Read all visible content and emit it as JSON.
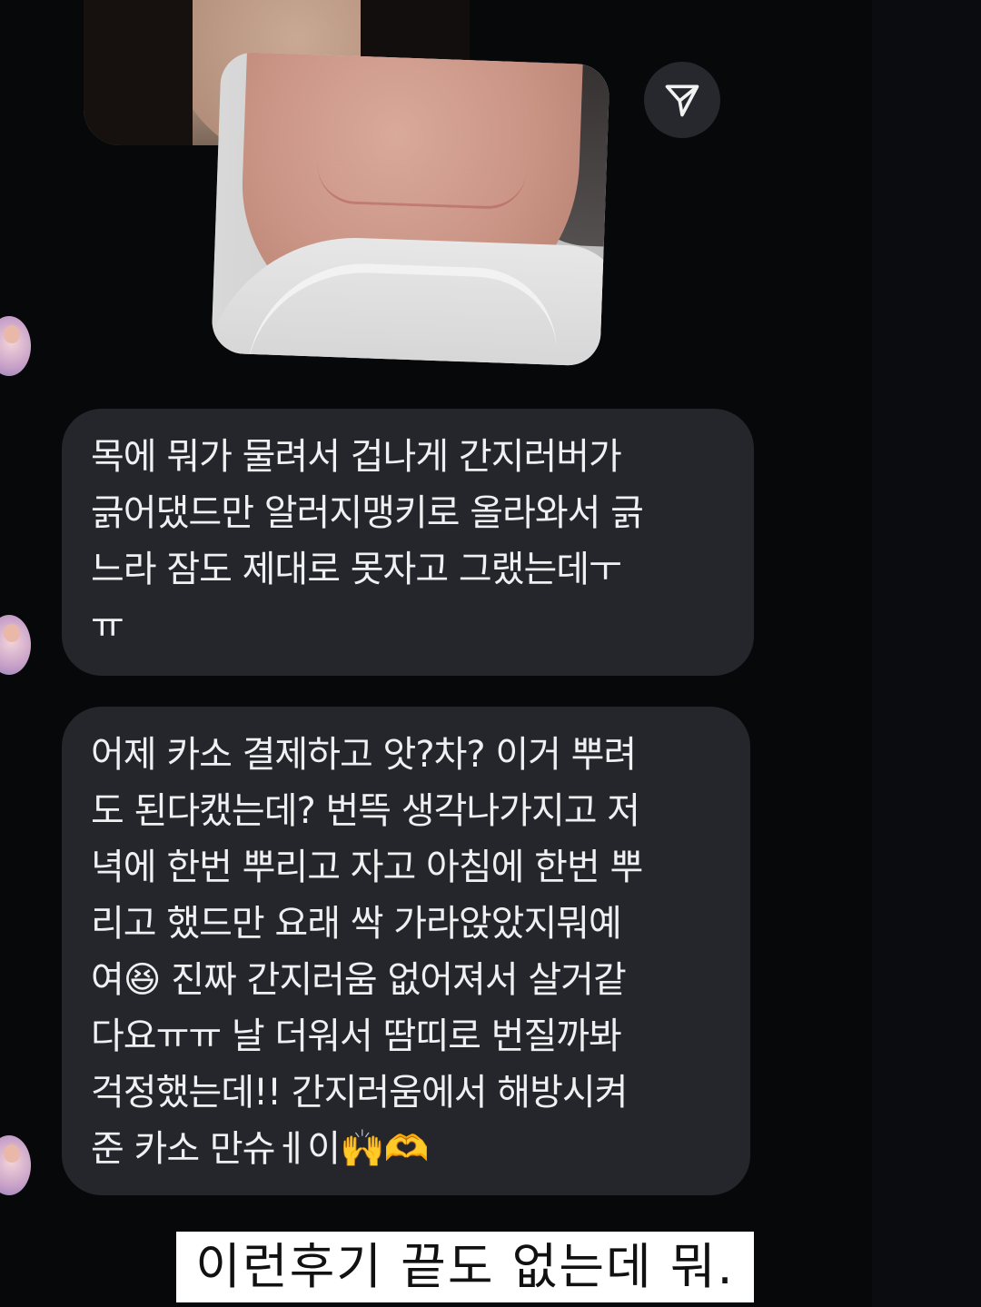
{
  "messages": [
    {
      "text": "목에 뭐가 물려서 겁나게 간지러버가\n긁어댔드만 알러지맹키로 올라와서 긁\n느라 잠도 제대로 못자고 그랬는데ㅜ\nㅠ"
    },
    {
      "text": "어제 카소 결제하고 앗?차? 이거 뿌려\n도 된다캤는데? 번뜩 생각나가지고 저\n녁에 한번 뿌리고 자고 아침에 한번 뿌\n리고 했드만 요래 싹 가라앉았지뭐예\n여😆 진짜 간지러움 없어져서 살거같\n다요ㅠㅠ 날 더워서 땀띠로 번질까봐\n걱정했는데!! 간지러움에서 해방시켜\n준 카소 만슈ㅔ이🙌🫶"
    }
  ],
  "caption": "이런후기 끝도 없는데 뭐.",
  "icons": {
    "share": "paper-plane-icon",
    "avatar": "profile-avatar"
  },
  "colors": {
    "background": "#07080a",
    "bubble": "#25262b",
    "share_button": "#26282d"
  }
}
